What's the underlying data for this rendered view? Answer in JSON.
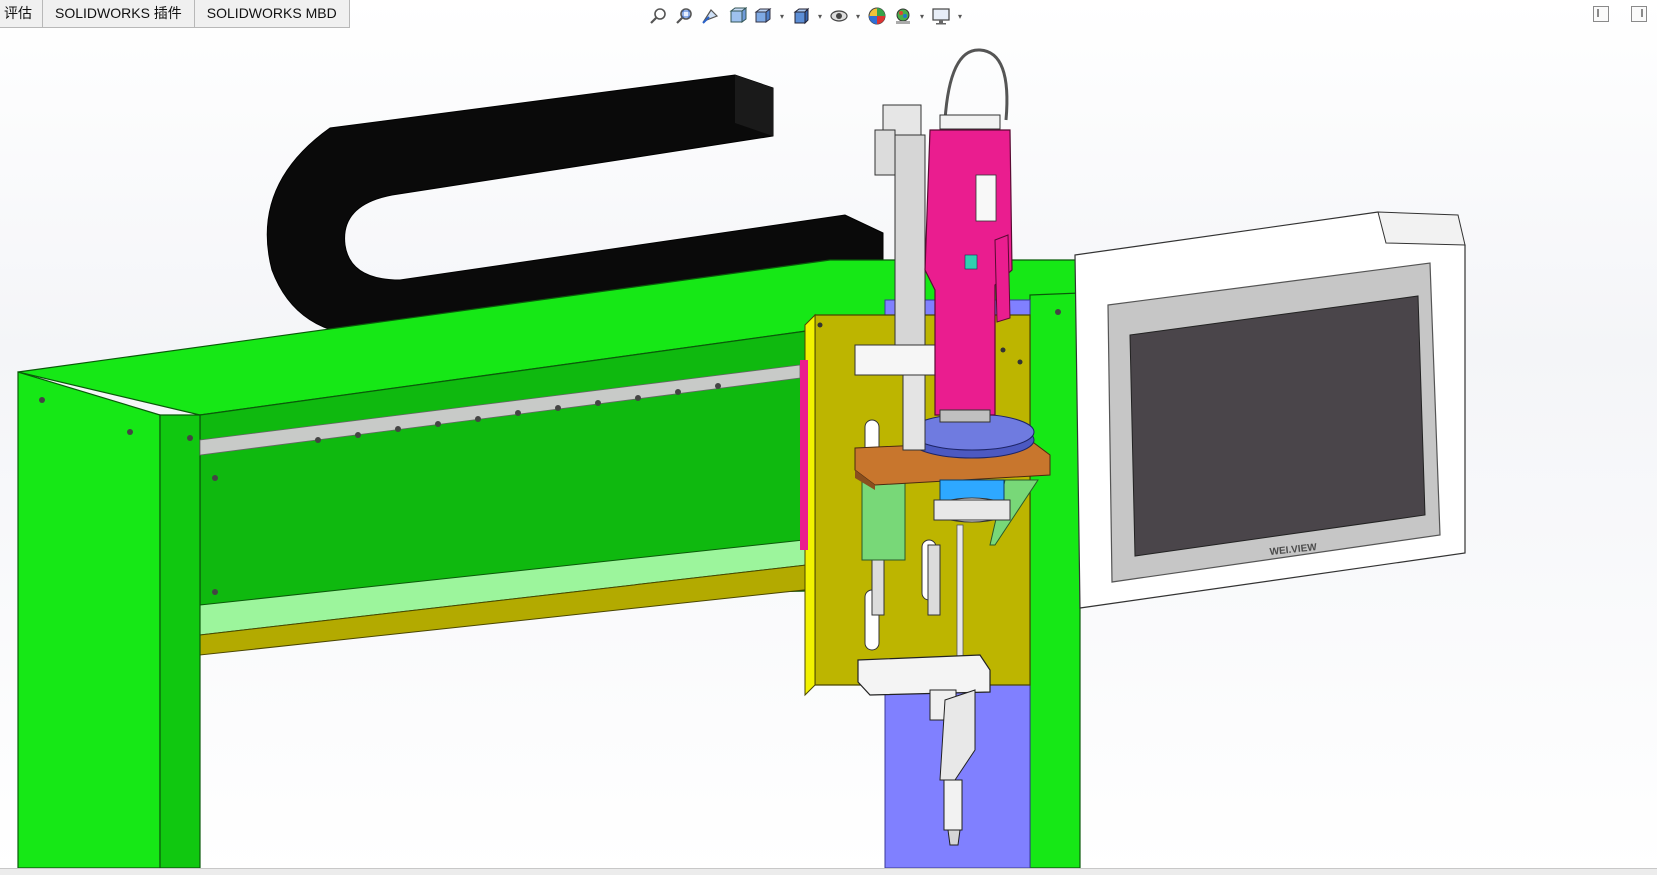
{
  "tabs": [
    {
      "label": "评估"
    },
    {
      "label": "SOLIDWORKS 插件"
    },
    {
      "label": "SOLIDWORKS MBD"
    }
  ],
  "heads_up_toolbar": {
    "icons": [
      "zoom-to-fit-icon",
      "zoom-to-area-icon",
      "previous-view-icon",
      "section-view-icon",
      "view-orientation-icon",
      "display-style-icon",
      "hide-show-items-icon",
      "edit-appearance-icon",
      "apply-scene-icon",
      "view-settings-icon"
    ]
  },
  "monitor": {
    "brand_label": "WEI.VIEW"
  },
  "colors": {
    "frame_green": "#16e816",
    "drag_chain": "#0a0a0a",
    "mount_plate_yellow": "#bdb500",
    "screwdriver_pink": "#ea1d8f",
    "bracket_orange": "#c8762d",
    "back_plate_blue": "#8080ff",
    "monitor_screen": "#4a454a"
  }
}
